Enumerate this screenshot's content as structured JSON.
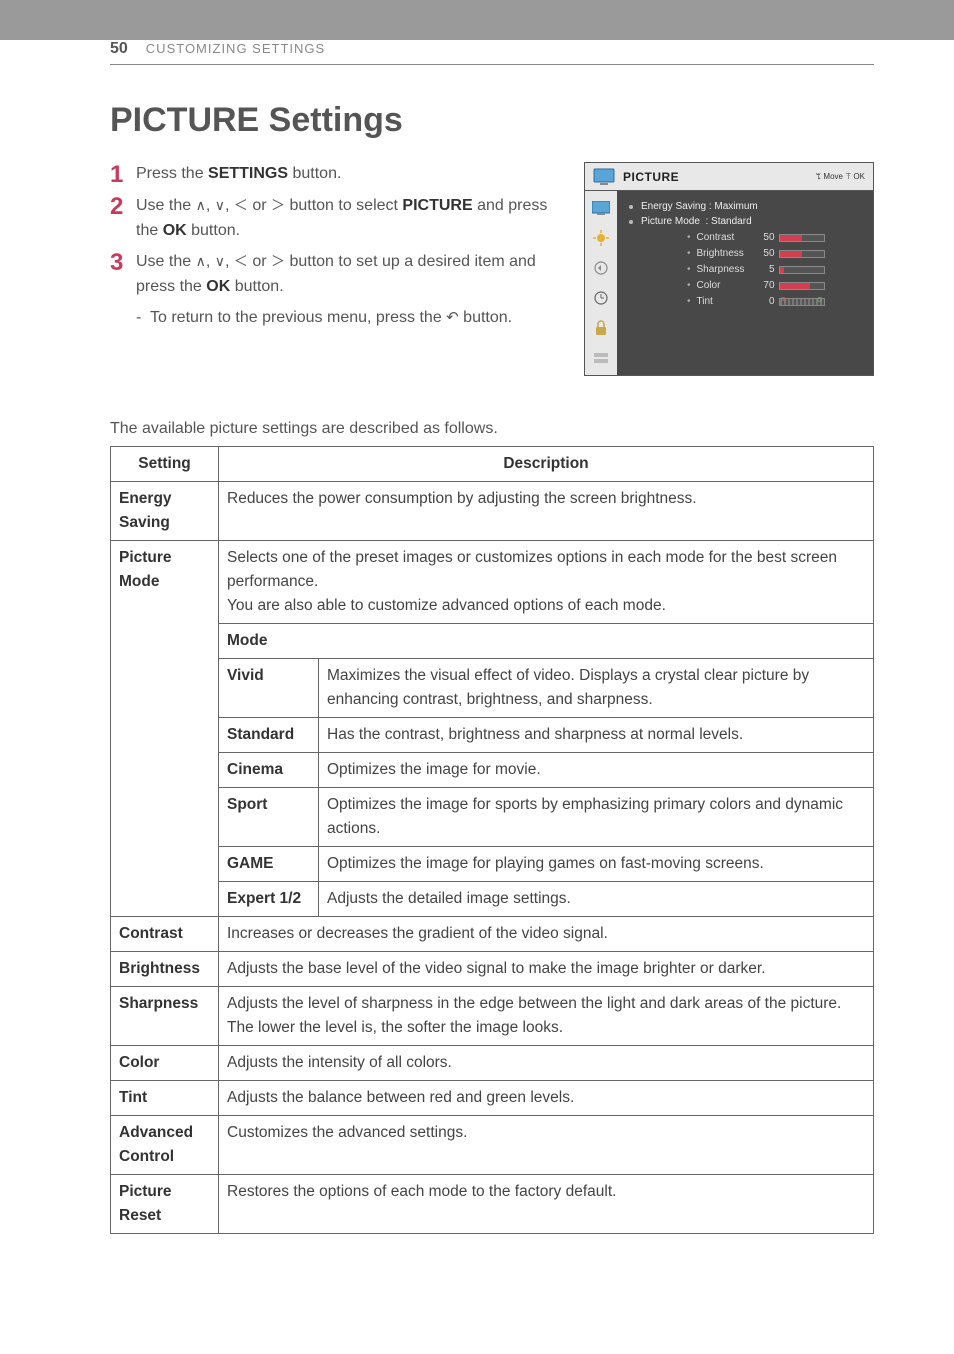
{
  "page": {
    "number": "50",
    "section": "CUSTOMIZING SETTINGS",
    "title": "PICTURE Settings"
  },
  "steps": {
    "s1_pre": "Press the ",
    "s1_b": "SETTINGS",
    "s1_post": " button.",
    "s2_pre": "Use the ",
    "s2_mid": " button to select ",
    "s2_b": "PICTURE",
    "s2_post": " and press the ",
    "s2_ok": "OK",
    "s2_end": " button.",
    "s3_pre": "Use the ",
    "s3_mid": " button to set up a desired item and press the ",
    "s3_ok": "OK",
    "s3_end": " button.",
    "sub_pre": "To return to the previous menu, press the ",
    "sub_post": " button."
  },
  "osd": {
    "title": "PICTURE",
    "hint": "ꔂ Move ꔉ OK",
    "line1_label": "Energy Saving",
    "line1_val": "Maximum",
    "line2_label": "Picture Mode",
    "line2_val": "Standard",
    "sliders": [
      {
        "label": "Contrast",
        "val": "50",
        "pct": 50
      },
      {
        "label": "Brightness",
        "val": "50",
        "pct": 50
      },
      {
        "label": "Sharpness",
        "val": "5",
        "pct": 11
      },
      {
        "label": "Color",
        "val": "70",
        "pct": 70
      },
      {
        "label": "Tint",
        "val": "0",
        "pct": 0,
        "tint": true
      }
    ]
  },
  "intro": "The available picture settings are described as follows.",
  "table": {
    "head_setting": "Setting",
    "head_desc": "Description",
    "energy_label": "Energy Saving",
    "energy_desc": "Reduces the power consumption by adjusting the screen brightness.",
    "pmode_label": "Picture Mode",
    "pmode_desc": "Selects one of the preset images or customizes options in each mode for the best screen performance.\nYou are also able to customize advanced options of each mode.",
    "mode_head": "Mode",
    "modes": {
      "vivid_l": "Vivid",
      "vivid_d": "Maximizes the visual effect of video. Displays a crystal clear picture by enhancing contrast, brightness, and sharpness.",
      "standard_l": "Standard",
      "standard_d": "Has the contrast, brightness and sharpness at normal levels.",
      "cinema_l": "Cinema",
      "cinema_d": "Optimizes the image for movie.",
      "sport_l": "Sport",
      "sport_d": "Optimizes the image for sports by emphasizing primary colors and dynamic actions.",
      "game_l": "GAME",
      "game_d": "Optimizes the image for playing games on fast-moving screens.",
      "expert_l": "Expert 1/2",
      "expert_d": "Adjusts the detailed image settings."
    },
    "contrast_l": "Contrast",
    "contrast_d": "Increases or decreases the gradient of the video signal.",
    "brightness_l": "Brightness",
    "brightness_d": "Adjusts the base level of the video signal to make the image brighter or darker.",
    "sharpness_l": "Sharpness",
    "sharpness_d": "Adjusts the level of sharpness in the edge between the light and dark areas of the picture. The lower the level is, the softer the image looks.",
    "color_l": "Color",
    "color_d": "Adjusts the intensity of all colors.",
    "tint_l": "Tint",
    "tint_d": "Adjusts the balance between red and green levels.",
    "adv_l": "Advanced Control",
    "adv_d": "Customizes the advanced settings.",
    "reset_l": "Picture Reset",
    "reset_d": "Restores the options of each mode to the factory default."
  }
}
